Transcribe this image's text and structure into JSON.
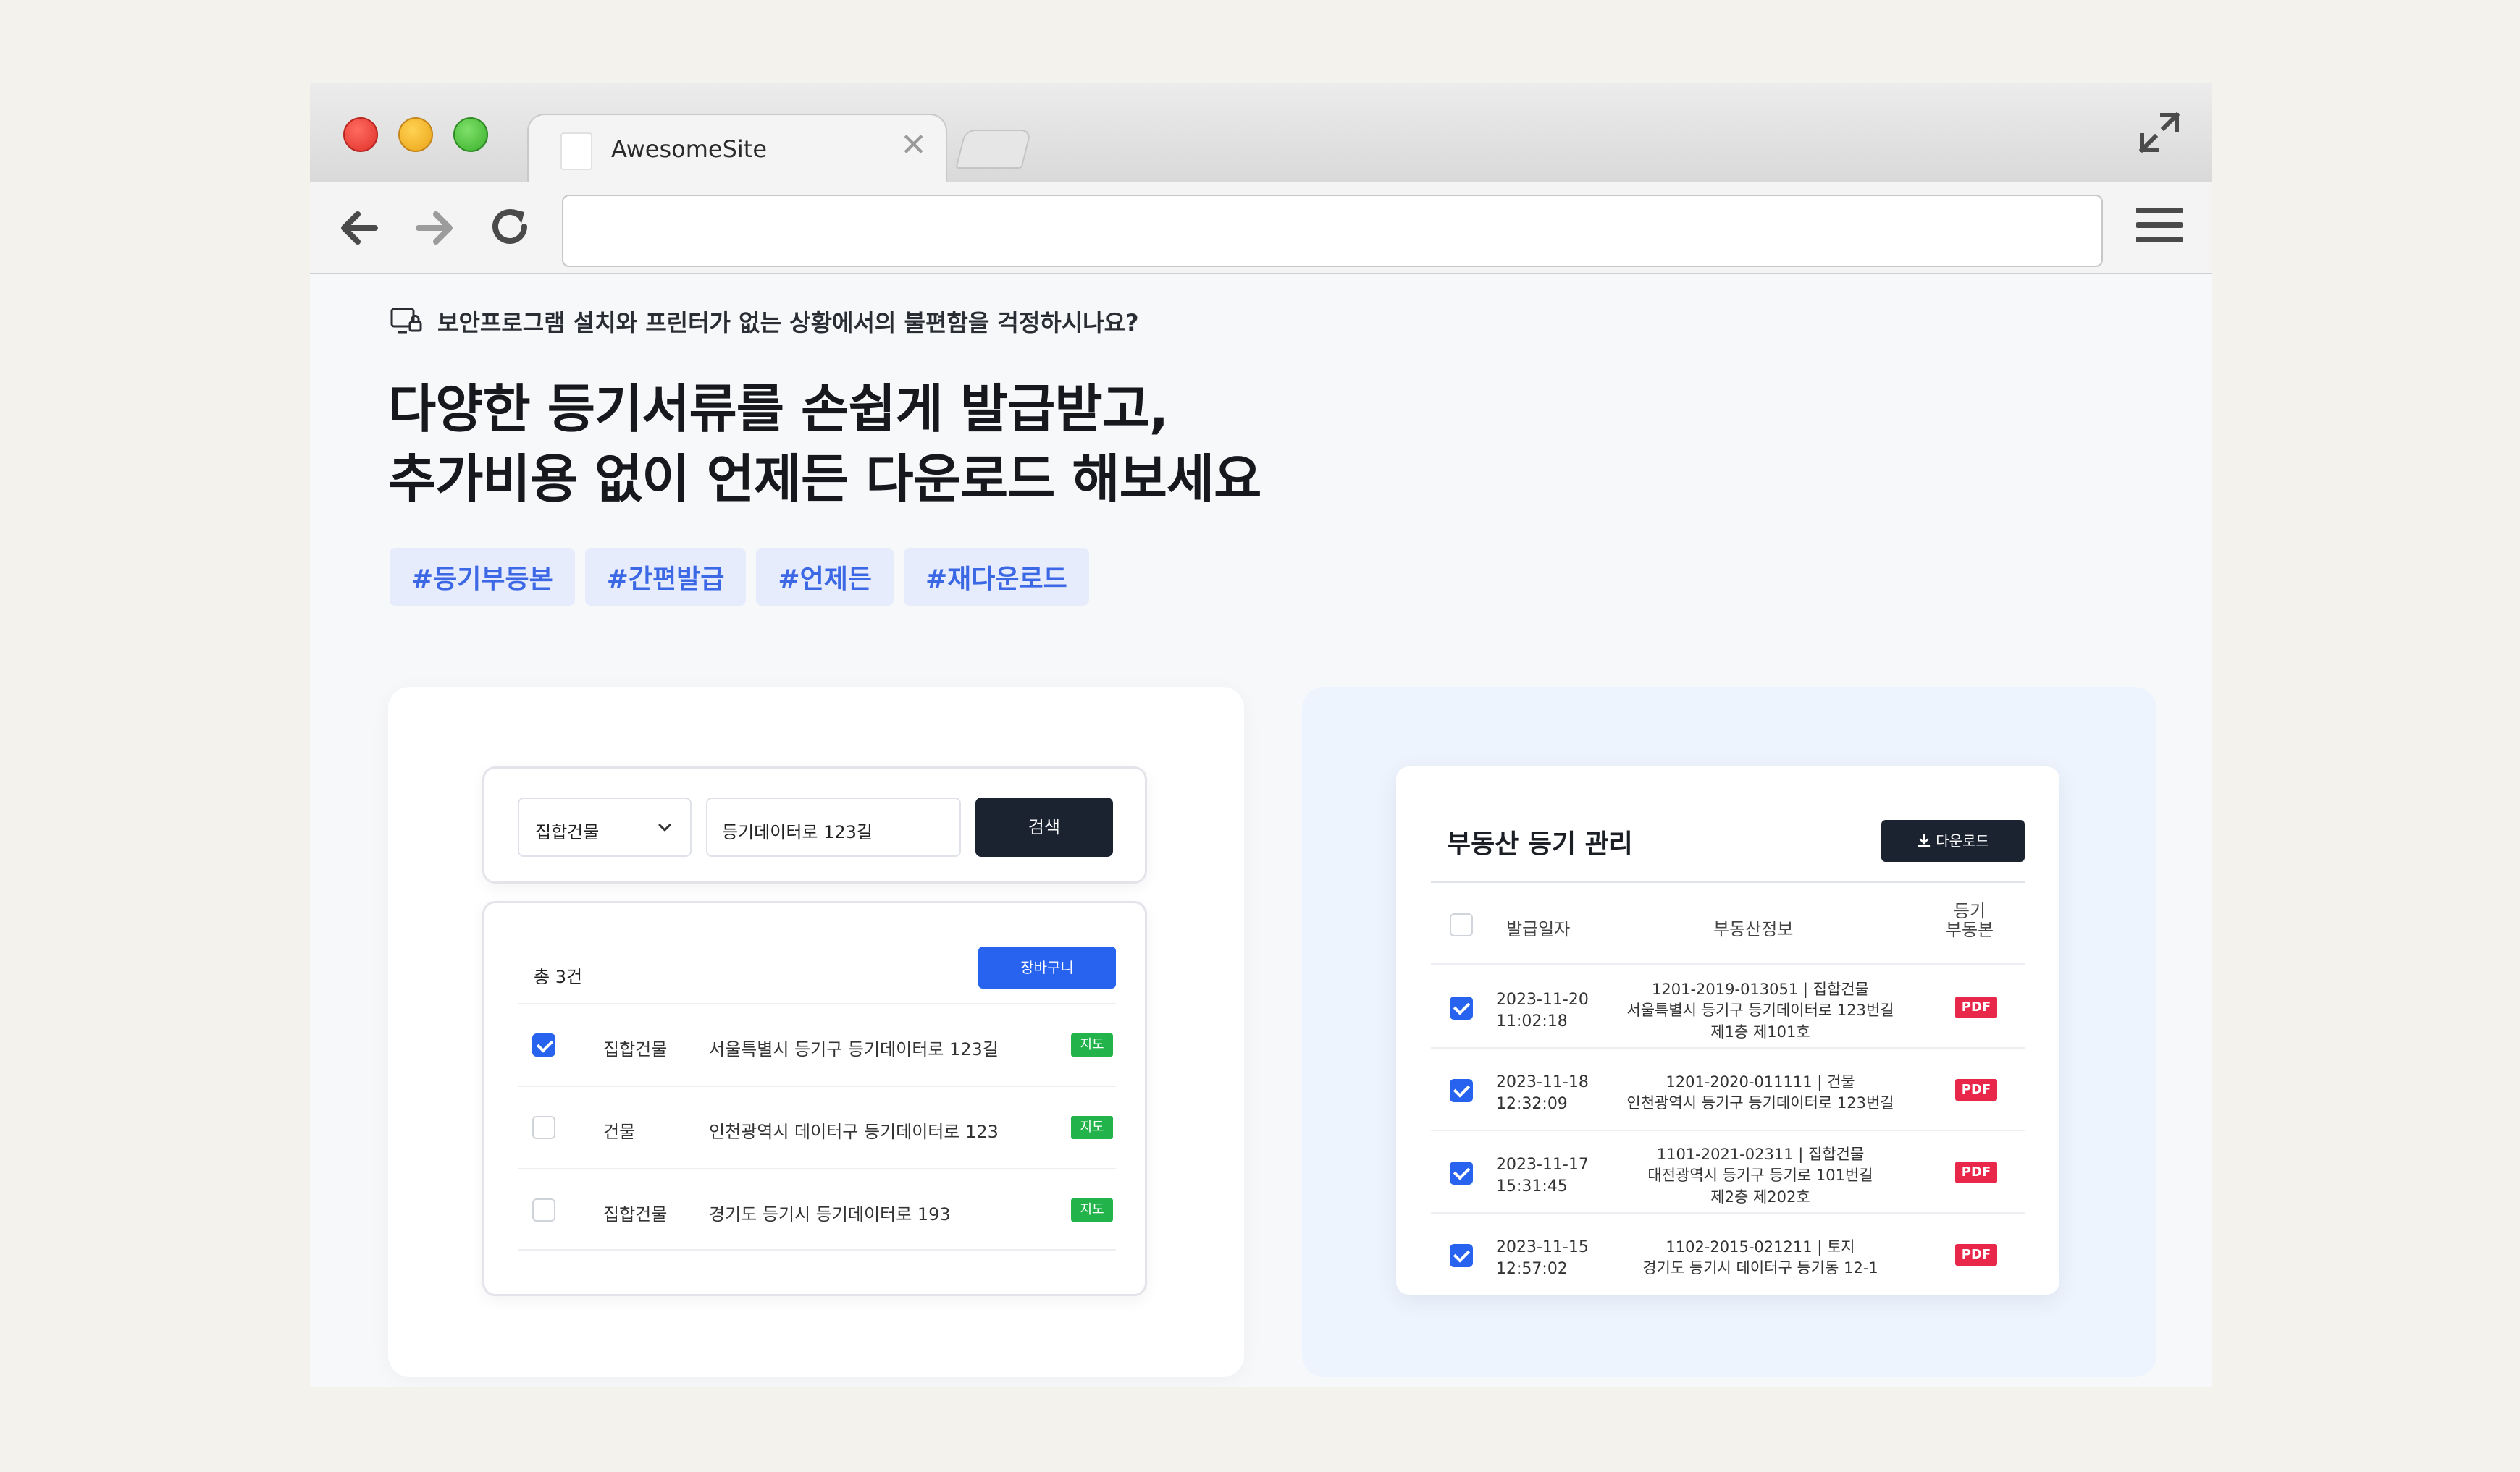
{
  "browser": {
    "tab_title": "AwesomeSite",
    "tab_close": "✕",
    "url": ""
  },
  "hero": {
    "notice": "보안프로그램 설치와 프린터가 없는 상황에서의 불편함을 걱정하시나요?",
    "headline_line1": "다양한 등기서류를 손쉽게 발급받고,",
    "headline_line2": "추가비용 없이 언제든 다운로드 해보세요",
    "tags": [
      "#등기부등본",
      "#간편발급",
      "#언제든",
      "#재다운로드"
    ]
  },
  "search": {
    "type_value": "집합건물",
    "query_value": "등기데이터로 123길",
    "button_label": "검색"
  },
  "results": {
    "count_label": "총 3건",
    "cart_label": "장바구니",
    "rows": [
      {
        "checked": true,
        "type": "집합건물",
        "address": "서울특별시 등기구 등기데이터로 123길",
        "map_label": "지도"
      },
      {
        "checked": false,
        "type": "건물",
        "address": "인천광역시 데이터구 등기데이터로 123",
        "map_label": "지도"
      },
      {
        "checked": false,
        "type": "집합건물",
        "address": "경기도 등기시 등기데이터로 193",
        "map_label": "지도"
      }
    ]
  },
  "registry": {
    "title": "부동산 등기 관리",
    "download_label": "다운로드",
    "columns": {
      "date": "발급일자",
      "info": "부동산정보",
      "doc_line1": "등기",
      "doc_line2": "부동본"
    },
    "rows": [
      {
        "date": "2023-11-20",
        "time": "11:02:18",
        "info1": "1201-2019-013051 | 집합건물",
        "info2": "서울특별시 등기구 등기데이터로 123번길",
        "info3": "제1층 제101호",
        "doc": "PDF"
      },
      {
        "date": "2023-11-18",
        "time": "12:32:09",
        "info1": "1201-2020-011111 | 건물",
        "info2": "인천광역시 등기구 등기데이터로 123번길",
        "info3": "",
        "doc": "PDF"
      },
      {
        "date": "2023-11-17",
        "time": "15:31:45",
        "info1": "1101-2021-02311 | 집합건물",
        "info2": "대전광역시 등기구 등기로 101번길",
        "info3": "제2층 제202호",
        "doc": "PDF"
      },
      {
        "date": "2023-11-15",
        "time": "12:57:02",
        "info1": "1102-2015-021211 | 토지",
        "info2": "경기도 등기시 데이터구 등기동 12-1",
        "info3": "",
        "doc": "PDF"
      }
    ]
  },
  "colors": {
    "accent_blue": "#2763ee",
    "dark_button": "#1b2230",
    "map_green": "#22b34a",
    "pdf_red": "#e8274a",
    "tag_bg": "#e6ecfb"
  },
  "icons": {
    "expand": "expand-icon",
    "back": "arrow-left-icon",
    "forward": "arrow-right-icon",
    "reload": "reload-icon",
    "menu": "hamburger-menu-icon",
    "notice": "monitor-lock-icon",
    "dropdown": "chevron-down-icon",
    "download": "download-icon"
  }
}
